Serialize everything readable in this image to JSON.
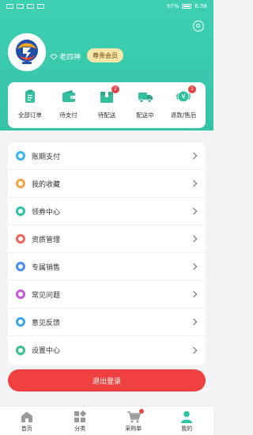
{
  "status_bar": {
    "battery": "97%",
    "time": "6:56"
  },
  "profile": {
    "username": "老四神",
    "vip_label": "尊贵会员"
  },
  "orders": [
    {
      "label": "全部订单",
      "icon": "clipboard-icon",
      "badge": ""
    },
    {
      "label": "待支付",
      "icon": "wallet-icon",
      "badge": ""
    },
    {
      "label": "待配送",
      "icon": "box-icon",
      "badge": "2"
    },
    {
      "label": "配送中",
      "icon": "truck-icon",
      "badge": ""
    },
    {
      "label": "退款/售后",
      "icon": "refund-icon",
      "badge": "1"
    }
  ],
  "menu": [
    {
      "label": "账期支付",
      "icon": "payment-term-icon",
      "color": "#3db3f0"
    },
    {
      "label": "我的收藏",
      "icon": "favorite-icon",
      "color": "#f5a44a"
    },
    {
      "label": "领券中心",
      "icon": "coupon-icon",
      "color": "#2fc3a5"
    },
    {
      "label": "资质管理",
      "icon": "qualification-icon",
      "color": "#f0645a"
    },
    {
      "label": "专属销售",
      "icon": "sales-icon",
      "color": "#4a8ff0"
    },
    {
      "label": "常见问题",
      "icon": "faq-icon",
      "color": "#c35ad6"
    },
    {
      "label": "意见反馈",
      "icon": "feedback-icon",
      "color": "#3ba5ea"
    },
    {
      "label": "设置中心",
      "icon": "settings-center-icon",
      "color": "#36c28d"
    }
  ],
  "logout_label": "退出登录",
  "tabs": [
    {
      "label": "首页",
      "icon": "home-icon"
    },
    {
      "label": "分类",
      "icon": "category-icon"
    },
    {
      "label": "采购单",
      "icon": "cart-icon"
    },
    {
      "label": "我的",
      "icon": "profile-icon"
    }
  ],
  "colors": {
    "header": "#3fd0b4",
    "accent": "#35c3a8",
    "logout": "#f04040",
    "badge": "#e64545",
    "vip_bg": "#f9e6a9"
  }
}
